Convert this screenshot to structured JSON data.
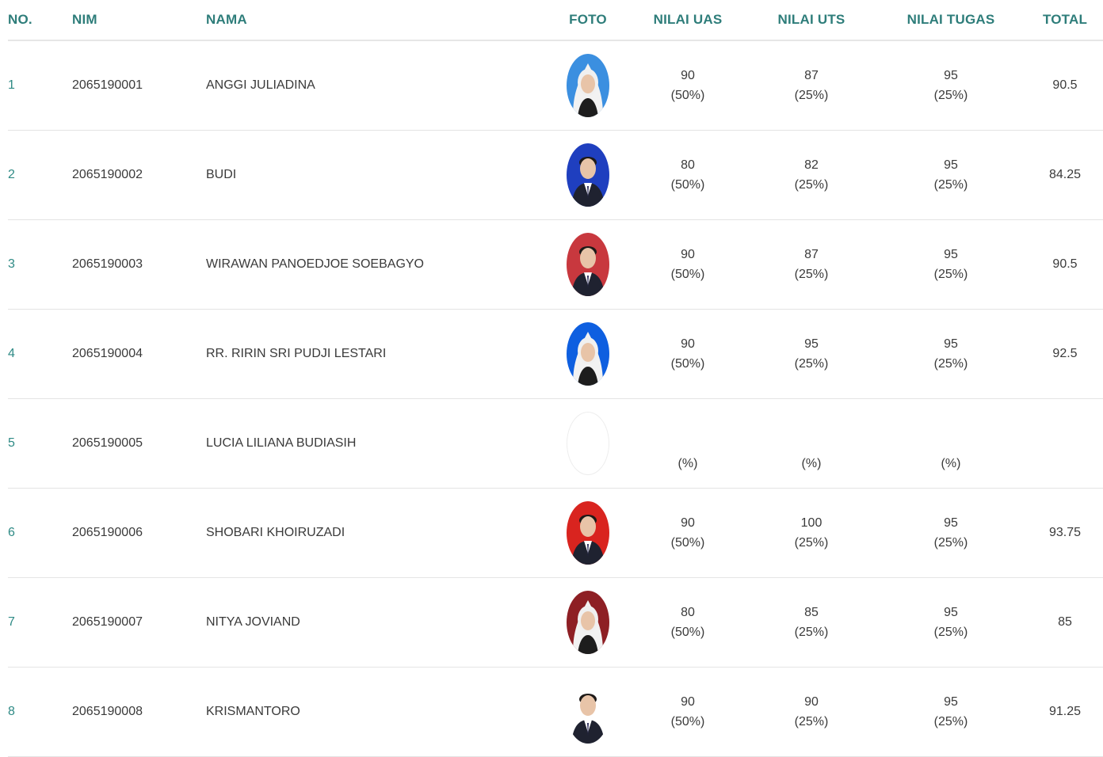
{
  "columns": {
    "no": "NO.",
    "nim": "NIM",
    "nama": "NAMA",
    "foto": "FOTO",
    "uas": "NILAI UAS",
    "uts": "NILAI UTS",
    "tugas": "NILAI TUGAS",
    "total": "TOTAL"
  },
  "colors": {
    "header_text": "#2e7d7a",
    "link": "#2e8a85",
    "body_text": "#3a3a3a",
    "row_border": "#e4e4e4"
  },
  "rows": [
    {
      "no": "1",
      "nim": "2065190001",
      "nama": "ANGGI JULIADINA",
      "photo_bg": "#3b8fe0",
      "photo": "hijab-woman-portrait",
      "uas": "90",
      "uas_pct": "(50%)",
      "uts": "87",
      "uts_pct": "(25%)",
      "tugas": "95",
      "tugas_pct": "(25%)",
      "total": "90.5"
    },
    {
      "no": "2",
      "nim": "2065190002",
      "nama": "BUDI",
      "photo_bg": "#1f3fbf",
      "photo": "man-portrait",
      "uas": "80",
      "uas_pct": "(50%)",
      "uts": "82",
      "uts_pct": "(25%)",
      "tugas": "95",
      "tugas_pct": "(25%)",
      "total": "84.25"
    },
    {
      "no": "3",
      "nim": "2065190003",
      "nama": "WIRAWAN PANOEDJOE SOEBAGYO",
      "photo_bg": "#c8383e",
      "photo": "man-portrait",
      "uas": "90",
      "uas_pct": "(50%)",
      "uts": "87",
      "uts_pct": "(25%)",
      "tugas": "95",
      "tugas_pct": "(25%)",
      "total": "90.5"
    },
    {
      "no": "4",
      "nim": "2065190004",
      "nama": "RR. RIRIN SRI PUDJI LESTARI",
      "photo_bg": "#0e5fe0",
      "photo": "hijab-woman-portrait",
      "uas": "90",
      "uas_pct": "(50%)",
      "uts": "95",
      "uts_pct": "(25%)",
      "tugas": "95",
      "tugas_pct": "(25%)",
      "total": "92.5"
    },
    {
      "no": "5",
      "nim": "2065190005",
      "nama": "LUCIA LILIANA BUDIASIH",
      "photo_bg": "#ffffff",
      "photo": "blank",
      "uas": "",
      "uas_pct": "(%)",
      "uts": "",
      "uts_pct": "(%)",
      "tugas": "",
      "tugas_pct": "(%)",
      "total": ""
    },
    {
      "no": "6",
      "nim": "2065190006",
      "nama": "SHOBARI KHOIRUZADI",
      "photo_bg": "#d9241f",
      "photo": "man-portrait",
      "uas": "90",
      "uas_pct": "(50%)",
      "uts": "100",
      "uts_pct": "(25%)",
      "tugas": "95",
      "tugas_pct": "(25%)",
      "total": "93.75"
    },
    {
      "no": "7",
      "nim": "2065190007",
      "nama": "NITYA JOVIAND",
      "photo_bg": "#8e1f24",
      "photo": "hijab-woman-portrait",
      "uas": "80",
      "uas_pct": "(50%)",
      "uts": "85",
      "uts_pct": "(25%)",
      "tugas": "95",
      "tugas_pct": "(25%)",
      "total": "85"
    },
    {
      "no": "8",
      "nim": "2065190008",
      "nama": "KRISMANTORO",
      "photo_bg": "#ffffff",
      "photo": "man-portrait",
      "uas": "90",
      "uas_pct": "(50%)",
      "uts": "90",
      "uts_pct": "(25%)",
      "tugas": "95",
      "tugas_pct": "(25%)",
      "total": "91.25"
    }
  ]
}
